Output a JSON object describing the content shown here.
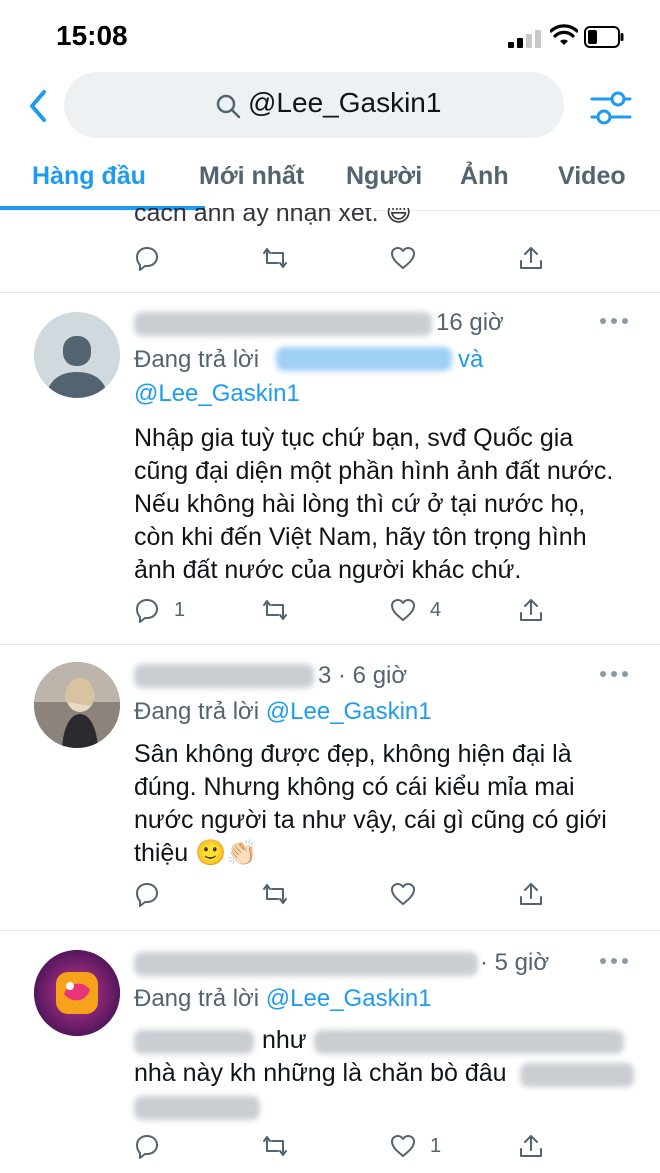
{
  "status_bar": {
    "time": "15:08"
  },
  "search": {
    "query": "@Lee_Gaskin1"
  },
  "tabs": [
    {
      "label": "Hàng đầu",
      "active": true
    },
    {
      "label": "Mới nhất"
    },
    {
      "label": "Người"
    },
    {
      "label": "Ảnh"
    },
    {
      "label": "Video"
    }
  ],
  "partial_tweet": {
    "text": "cách anh ấy nhận xét. 😄"
  },
  "tweets": [
    {
      "time": "16 giờ",
      "reply_prefix": "Đang trả lời",
      "reply_and": "và",
      "reply_mention": "@Lee_Gaskin1",
      "body": "Nhập gia tuỳ tục chứ bạn, svđ Quốc gia cũng đại diện một phần hình ảnh đất nước. Nếu không hài lòng thì cứ ở tại nước họ, còn khi đến Việt Nam, hãy tôn trọng hình ảnh đất nước của người khác chứ.",
      "reply_count": "1",
      "like_count": "4"
    },
    {
      "time": "3 · 6 giờ",
      "reply_prefix": "Đang trả lời",
      "reply_mention": "@Lee_Gaskin1",
      "body": "Sân không được đẹp, không hiện đại là đúng. Nhưng không có cái kiểu mỉa mai nước người ta như vậy, cái gì cũng có giới thiệu 🙂👏🏻"
    },
    {
      "time": "· 5 giờ",
      "reply_prefix": "Đang trả lời",
      "reply_mention": "@Lee_Gaskin1",
      "body_line1": "như",
      "body_line2": "nhà này kh những là chăn bò đâu",
      "like_count": "1"
    }
  ],
  "colors": {
    "accent": "#1d9bf0",
    "secondary": "#536471",
    "text": "#0f1419"
  }
}
